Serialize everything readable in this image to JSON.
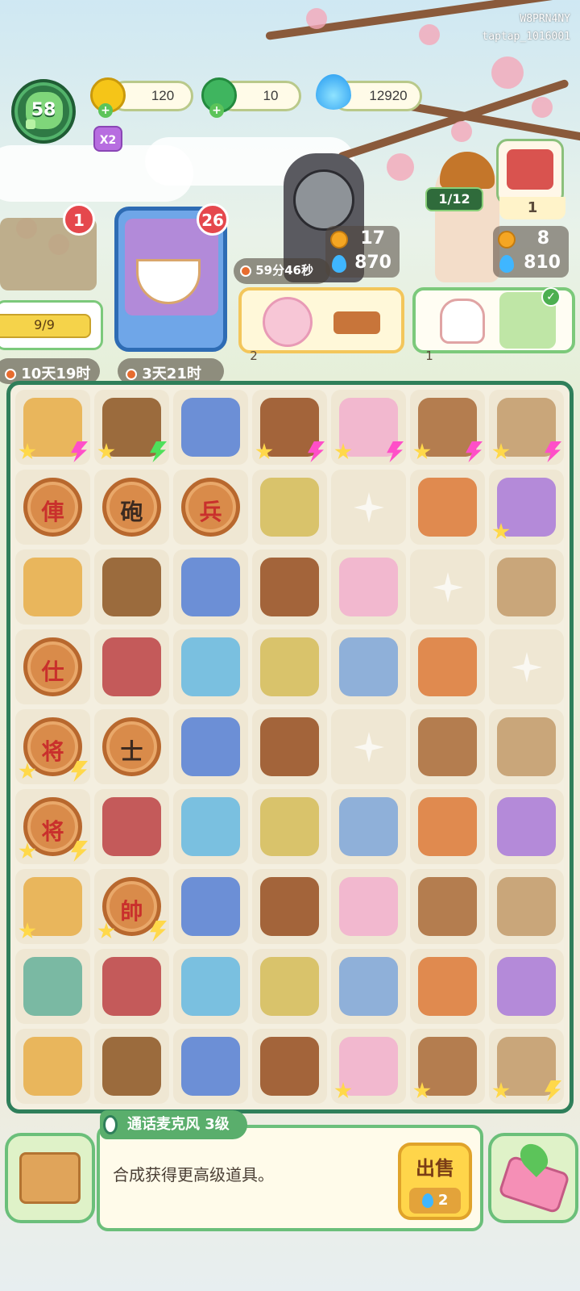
{
  "watermark": {
    "line1": "W8PRN4NY",
    "line2": "taptap_1016001"
  },
  "player": {
    "level": "58",
    "multiplier": "X2"
  },
  "resources": [
    {
      "icon": "energy-icon",
      "value": "120",
      "color": "#f5c518"
    },
    {
      "icon": "jade-coin-icon",
      "value": "10",
      "color": "#3fb55f"
    },
    {
      "icon": "blue-flame-icon",
      "value": "12920",
      "color": "#3fb6ff"
    }
  ],
  "events": {
    "left_badge": "1",
    "left_progress": "9/9",
    "left_timer": "10天19时",
    "card_badge": "26",
    "card_timer": "3天21时"
  },
  "customers": {
    "a": {
      "timer": "59分46秒",
      "coins": "17",
      "flames": "870",
      "order_count": "2"
    },
    "b": {
      "progress": "1/12",
      "coins": "8",
      "flames": "810",
      "shop_count": "1",
      "order_count": "1"
    }
  },
  "board": {
    "rows": [
      [
        "building",
        "treasure-box",
        "book",
        "shrine",
        "gift-bag",
        "cabinet",
        "camera"
      ],
      [
        "chess-red-pao",
        "chess-black-pao",
        "chess-red-bing",
        "water-pistol",
        "empty",
        "microphone-stand",
        "fan-pair"
      ],
      [
        "teapot",
        "bowl",
        "photo",
        "planet-gem",
        "slinky",
        "empty",
        "plane-tool"
      ],
      [
        "chess-red-shi",
        "jewelry-box",
        "microphone",
        "sword",
        "microphone-2",
        "coin-paper",
        "empty"
      ],
      [
        "chess-red-jiang",
        "chess-black-shi",
        "shoe",
        "stool",
        "empty",
        "wedding-sedan",
        "robe"
      ],
      [
        "chess-red-jiang-2",
        "firecracker",
        "retro-mic",
        "tassel",
        "porcelain-jar",
        "wine-jar",
        "hammer"
      ],
      [
        "figure-girl",
        "chess-red-shuai",
        "lucky-bag",
        "pinwheel",
        "letters",
        "gold-bar",
        "ribbon"
      ],
      [
        "statue",
        "knot-charm",
        "pouch",
        "red-flower",
        "microwave",
        "general-figure",
        "cd-player"
      ],
      [
        "honey-jar",
        "folding-fan",
        "rice-cooker",
        "cd",
        "lotus",
        "computer",
        "coconut"
      ]
    ],
    "chess_chars": {
      "chess-red-pao": "俥",
      "chess-black-pao": "砲",
      "chess-red-bing": "兵",
      "chess-red-shi": "仕",
      "chess-red-jiang": "将",
      "chess-black-shi": "士",
      "chess-red-jiang-2": "将",
      "chess-red-shuai": "帥"
    }
  },
  "selected_item": {
    "name": "通话麦克风 3级",
    "description": "合成获得更高级道具。",
    "sell_label": "出售",
    "sell_price": "2"
  }
}
